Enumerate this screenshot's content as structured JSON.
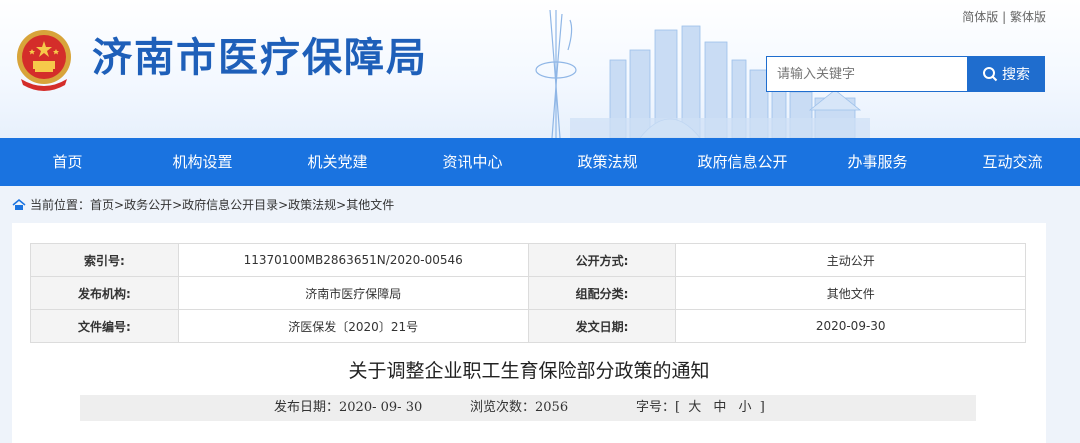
{
  "header": {
    "lang_simplified": "简体版",
    "lang_traditional": "繁体版",
    "lang_sep": "|",
    "site_title": "济南市医疗保障局",
    "search_placeholder": "请输入关键字",
    "search_button": "搜索",
    "brand_color": "#1a73e0"
  },
  "nav": {
    "items": [
      "首页",
      "机构设置",
      "机关党建",
      "资讯中心",
      "政策法规",
      "政府信息公开",
      "办事服务",
      "互动交流"
    ]
  },
  "breadcrumb": {
    "prefix": "当前位置：",
    "path": "首页>政务公开>政府信息公开目录>政策法规>其他文件"
  },
  "meta": {
    "rows": [
      {
        "k1": "索引号:",
        "v1": "11370100MB2863651N/2020-00546",
        "k2": "公开方式:",
        "v2": "主动公开"
      },
      {
        "k1": "发布机构:",
        "v1": "济南市医疗保障局",
        "k2": "组配分类:",
        "v2": "其他文件"
      },
      {
        "k1": "文件编号:",
        "v1": "济医保发〔2020〕21号",
        "k2": "发文日期:",
        "v2": "2020-09-30"
      }
    ]
  },
  "article": {
    "title": "关于调整企业职工生育保险部分政策的通知",
    "publish_label": "发布日期：",
    "publish_date": "2020- 09- 30",
    "views_label": "浏览次数：",
    "views": "2056",
    "font_size_label": "字号：[",
    "size_large": "大",
    "size_medium": "中",
    "size_small": "小",
    "font_size_close": "]"
  }
}
